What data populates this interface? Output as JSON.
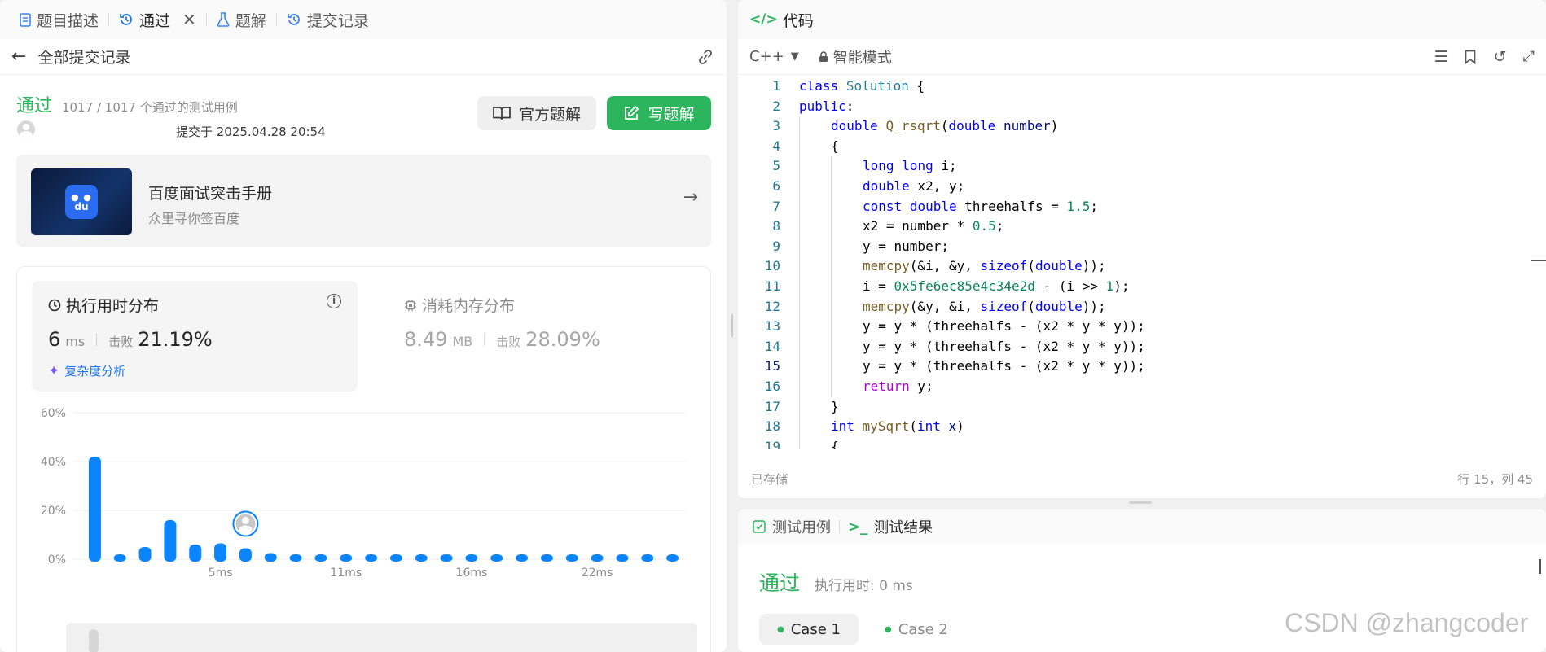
{
  "left_tabs": [
    {
      "label": "题目描述",
      "icon": "description-icon"
    },
    {
      "label": "通过",
      "icon": "history-icon"
    },
    {
      "label": "题解",
      "icon": "flask-icon"
    },
    {
      "label": "提交记录",
      "icon": "history-icon"
    }
  ],
  "back_label": "全部提交记录",
  "submission": {
    "status": "通过",
    "testcases": "1017 / 1017 个通过的测试用例",
    "submitted_at": "提交于 2025.04.28 20:54",
    "official_solution_label": "官方题解",
    "write_solution_label": "写题解"
  },
  "banner": {
    "title": "百度面试突击手册",
    "subtitle": "众里寻你签百度",
    "logo_text": "du"
  },
  "runtime": {
    "title": "执行用时分布",
    "value": "6",
    "unit": "ms",
    "beats_label": "击败",
    "beats": "21.19%",
    "complexity_label": "复杂度分析"
  },
  "memory": {
    "title": "消耗内存分布",
    "value": "8.49",
    "unit": "MB",
    "beats_label": "击败",
    "beats": "28.09%"
  },
  "chart_data": {
    "type": "bar",
    "title": "",
    "ylabel": "",
    "xlabel": "",
    "ylim": [
      0,
      60
    ],
    "y_ticks": [
      "60%",
      "40%",
      "20%",
      "0%"
    ],
    "x_tick_labels": [
      "5ms",
      "11ms",
      "16ms",
      "22ms"
    ],
    "x_tick_positions": [
      5,
      10,
      15,
      20
    ],
    "values": [
      42,
      1.5,
      5,
      16,
      6,
      6.5,
      4.5,
      2.5,
      1.5,
      1.5,
      1.5,
      1.5,
      1.5,
      1.5,
      1.5,
      1.5,
      1.5,
      1.5,
      1.5,
      1.5,
      1.5,
      1.5,
      1.5,
      1.5
    ],
    "highlight_index": 6,
    "colors": {
      "bar": "#0a84ff",
      "grid": "#ececec",
      "tick": "#8c8c8c"
    }
  },
  "code_panel": {
    "tab_label": "代码",
    "language": "C++",
    "mode": "智能模式",
    "saved": "已存储",
    "cursor": "行 15，列 45"
  },
  "code_lines": [
    {
      "n": "1",
      "indent": 0,
      "html": "<span class='kw'>class</span> <span class='ty'>Solution</span> {"
    },
    {
      "n": "2",
      "indent": 0,
      "html": "<span class='kw'>public</span>:"
    },
    {
      "n": "3",
      "indent": 1,
      "html": "<span class='kw'>double</span> <span class='fn'>Q_rsqrt</span>(<span class='kw'>double</span> <span class='vr'>number</span>)"
    },
    {
      "n": "4",
      "indent": 1,
      "html": "{"
    },
    {
      "n": "5",
      "indent": 2,
      "html": "<span class='kw'>long</span> <span class='kw'>long</span> i;"
    },
    {
      "n": "6",
      "indent": 2,
      "html": "<span class='kw'>double</span> x2, y;"
    },
    {
      "n": "7",
      "indent": 2,
      "html": "<span class='kw'>const</span> <span class='kw'>double</span> threehalfs = <span class='nm'>1.5</span>;"
    },
    {
      "n": "8",
      "indent": 2,
      "html": "x2 = number * <span class='nm'>0.5</span>;"
    },
    {
      "n": "9",
      "indent": 2,
      "html": "y = number;"
    },
    {
      "n": "10",
      "indent": 2,
      "html": "<span class='fn'>memcpy</span>(&amp;i, &amp;y, <span class='kw'>sizeof</span>(<span class='kw'>double</span>));"
    },
    {
      "n": "11",
      "indent": 2,
      "html": "i = <span class='nm'>0x5fe6ec85e4c34e2d</span> - (i &gt;&gt; <span class='nm'>1</span>);"
    },
    {
      "n": "12",
      "indent": 2,
      "html": "<span class='fn'>memcpy</span>(&amp;y, &amp;i, <span class='kw'>sizeof</span>(<span class='kw'>double</span>));"
    },
    {
      "n": "13",
      "indent": 2,
      "html": "y = y * (threehalfs - (x2 * y * y));"
    },
    {
      "n": "14",
      "indent": 2,
      "html": "y = y * (threehalfs - (x2 * y * y));"
    },
    {
      "n": "15",
      "indent": 2,
      "html": "y = y * (threehalfs - (x2 * y * y));"
    },
    {
      "n": "16",
      "indent": 2,
      "html": "<span class='ctl'>return</span> y;"
    },
    {
      "n": "17",
      "indent": 1,
      "html": "}"
    },
    {
      "n": "18",
      "indent": 1,
      "html": "<span class='kw'>int</span> <span class='fn'>mySqrt</span>(<span class='kw'>int</span> <span class='vr'>x</span>)"
    },
    {
      "n": "19",
      "indent": 1,
      "html": "{"
    }
  ],
  "result_panel": {
    "tabs": [
      "测试用例",
      "测试结果"
    ],
    "status": "通过",
    "runtime": "执行用时: 0 ms",
    "cases": [
      "Case 1",
      "Case 2"
    ]
  },
  "watermark": "CSDN @zhangcoder"
}
